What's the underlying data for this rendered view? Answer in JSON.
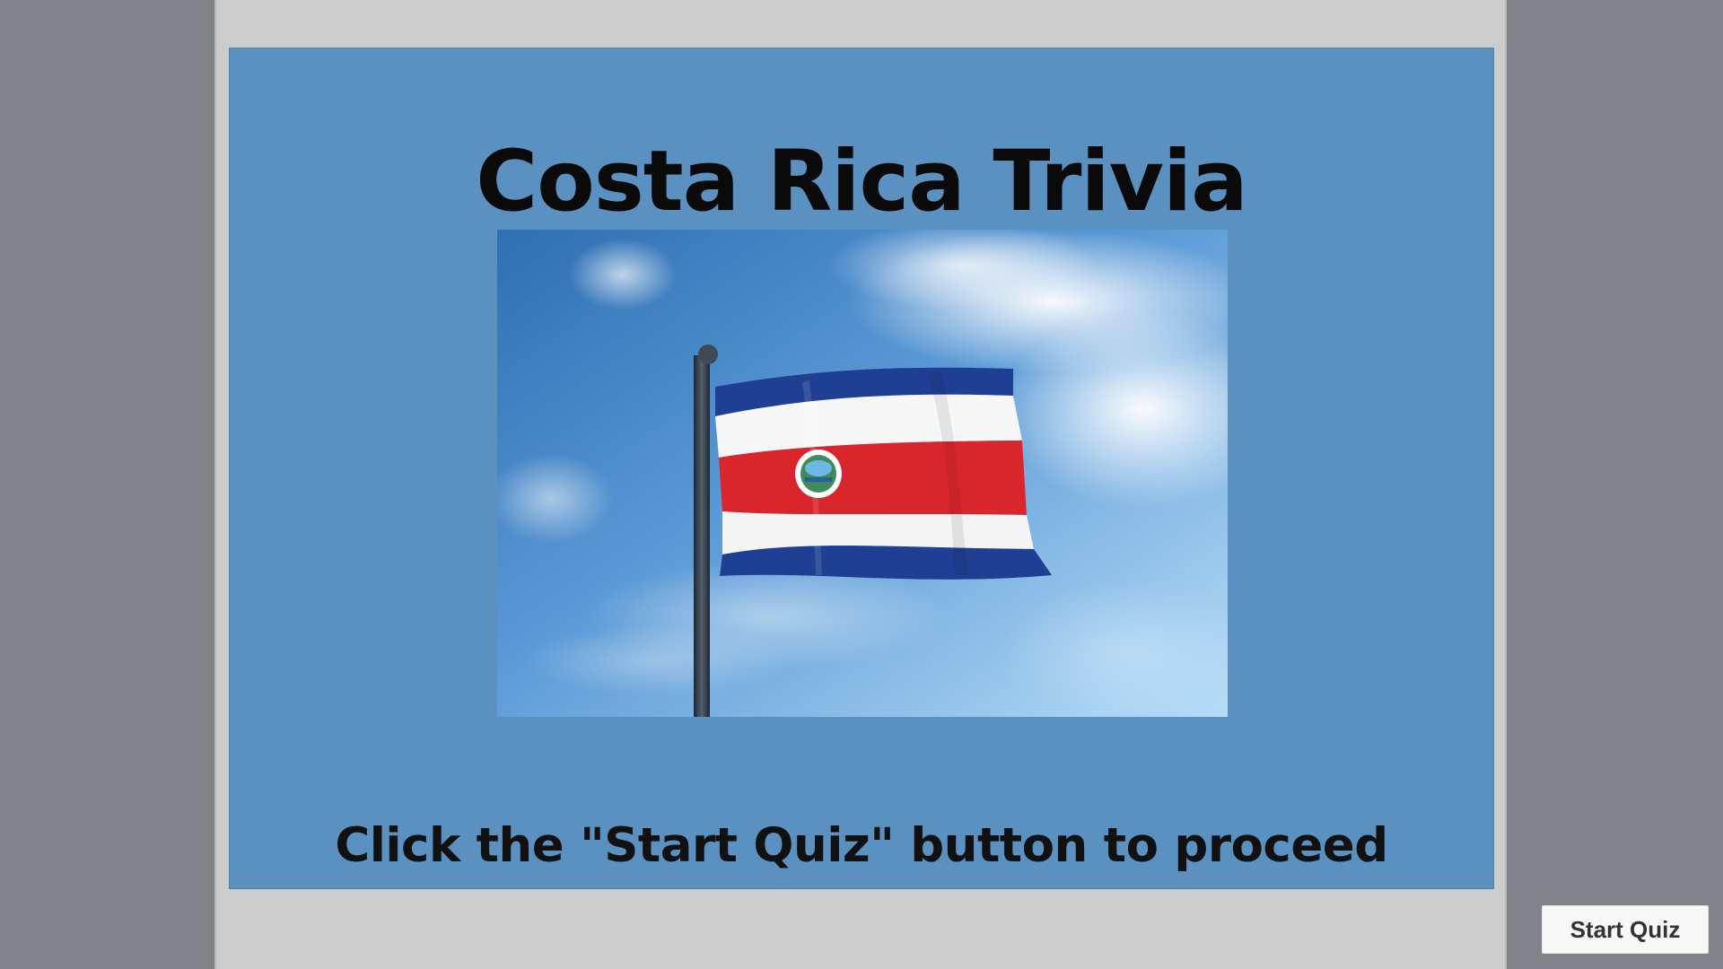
{
  "slide": {
    "title": "Costa Rica Trivia",
    "instruction": "Click the \"Start Quiz\" button to proceed",
    "image_subject": "costa-rica-flag"
  },
  "controls": {
    "start_label": "Start Quiz"
  },
  "colors": {
    "page_background": "#808387",
    "player_frame": "#cccccc",
    "slide_background": "#5b91c1",
    "flag_blue": "#1f3f94",
    "flag_white": "#ffffff",
    "flag_red": "#d9262c"
  }
}
